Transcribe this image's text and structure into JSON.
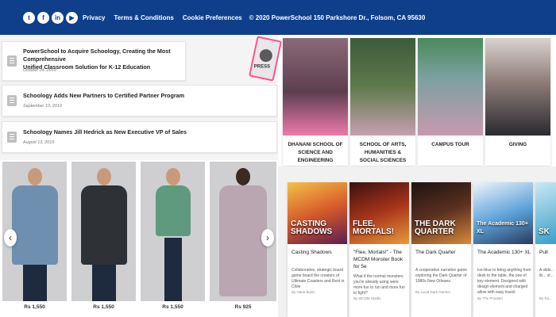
{
  "topbar": {
    "socials": [
      {
        "icon": "twitter-icon",
        "glyph": "t"
      },
      {
        "icon": "facebook-icon",
        "glyph": "f"
      },
      {
        "icon": "linkedin-icon",
        "glyph": "in"
      },
      {
        "icon": "youtube-icon",
        "glyph": "▶"
      }
    ],
    "links": [
      "Privacy",
      "Terms & Conditions",
      "Cookie Preferences"
    ],
    "address": "© 2020 PowerSchool 150 Parkshore Dr., Folsom, CA 95630",
    "bg_color": "#0f3f8a"
  },
  "news": [
    {
      "title_line1": "PowerSchool to Acquire Schoology, Creating the Most Comprehensive",
      "title_line2": "Unified Classroom Solution for K-12 Education",
      "date": "October 24, 2019"
    },
    {
      "title_line1": "Schoology Adds New Partners to Certified Partner Program",
      "title_line2": "",
      "date": "September 10, 2019"
    },
    {
      "title_line1": "Schoology Names Jill Hedrick as New Executive VP of Sales",
      "title_line2": "",
      "date": "August 13, 2019"
    }
  ],
  "press_badge": "PRESS",
  "cards": [
    {
      "label_line1": "DHANANI SCHOOL OF SCIENCE AND",
      "label_line2": "ENGINEERING"
    },
    {
      "label_line1": "SCHOOL OF ARTS, HUMANITIES &",
      "label_line2": "SOCIAL SCIENCES"
    },
    {
      "label_line1": "CAMPUS TOUR",
      "label_line2": ""
    },
    {
      "label_line1": "GIVING",
      "label_line2": ""
    }
  ],
  "products": [
    {
      "price": "Rs 1,550",
      "shirt_color": "#6f8fb0"
    },
    {
      "price": "Rs 1,550",
      "shirt_color": "#2e3236"
    },
    {
      "price": "Rs 1,550",
      "shirt_color": "#5f9a7e"
    },
    {
      "price": "Rs 925",
      "shirt_color": "#b9a6b0"
    }
  ],
  "carousel": {
    "prev_glyph": "‹",
    "next_glyph": "›"
  },
  "games": [
    {
      "title": "Casting Shadows",
      "img_text": "CASTING SHADOWS",
      "desc": "Collaborative, strategic board game board the creators of Ultimate Coasters and Rest in Chile",
      "author": "By Hana Budo"
    },
    {
      "title": "\"Flee, Mortals!\" - The MCDM Monster Book for 5e",
      "img_text": "FLEE, MORTALS!",
      "desc": "What if the normal monsters you're already using were more fun to run and more fun to fight?",
      "author": "By MCDM Studio"
    },
    {
      "title": "The Dark Quarter",
      "img_text": "THE DARK QUARTER",
      "desc": "A cooperative narrative game exploring the Dark Quarter of 1980s New Orleans.",
      "author": "By Lucid Dark Games"
    },
    {
      "title": "The Academic 130+ XL",
      "img_text": "The Academic 130+ XL",
      "desc": "Ice-blue to bring anything from desk to the table, the one of key element. Designed with design element and charged allow with easy travel.",
      "author": "By The Proxster"
    },
    {
      "title": "Pull",
      "img_text": "SK",
      "desc": "A slide... tb... st...",
      "author": "By Ka..."
    }
  ]
}
